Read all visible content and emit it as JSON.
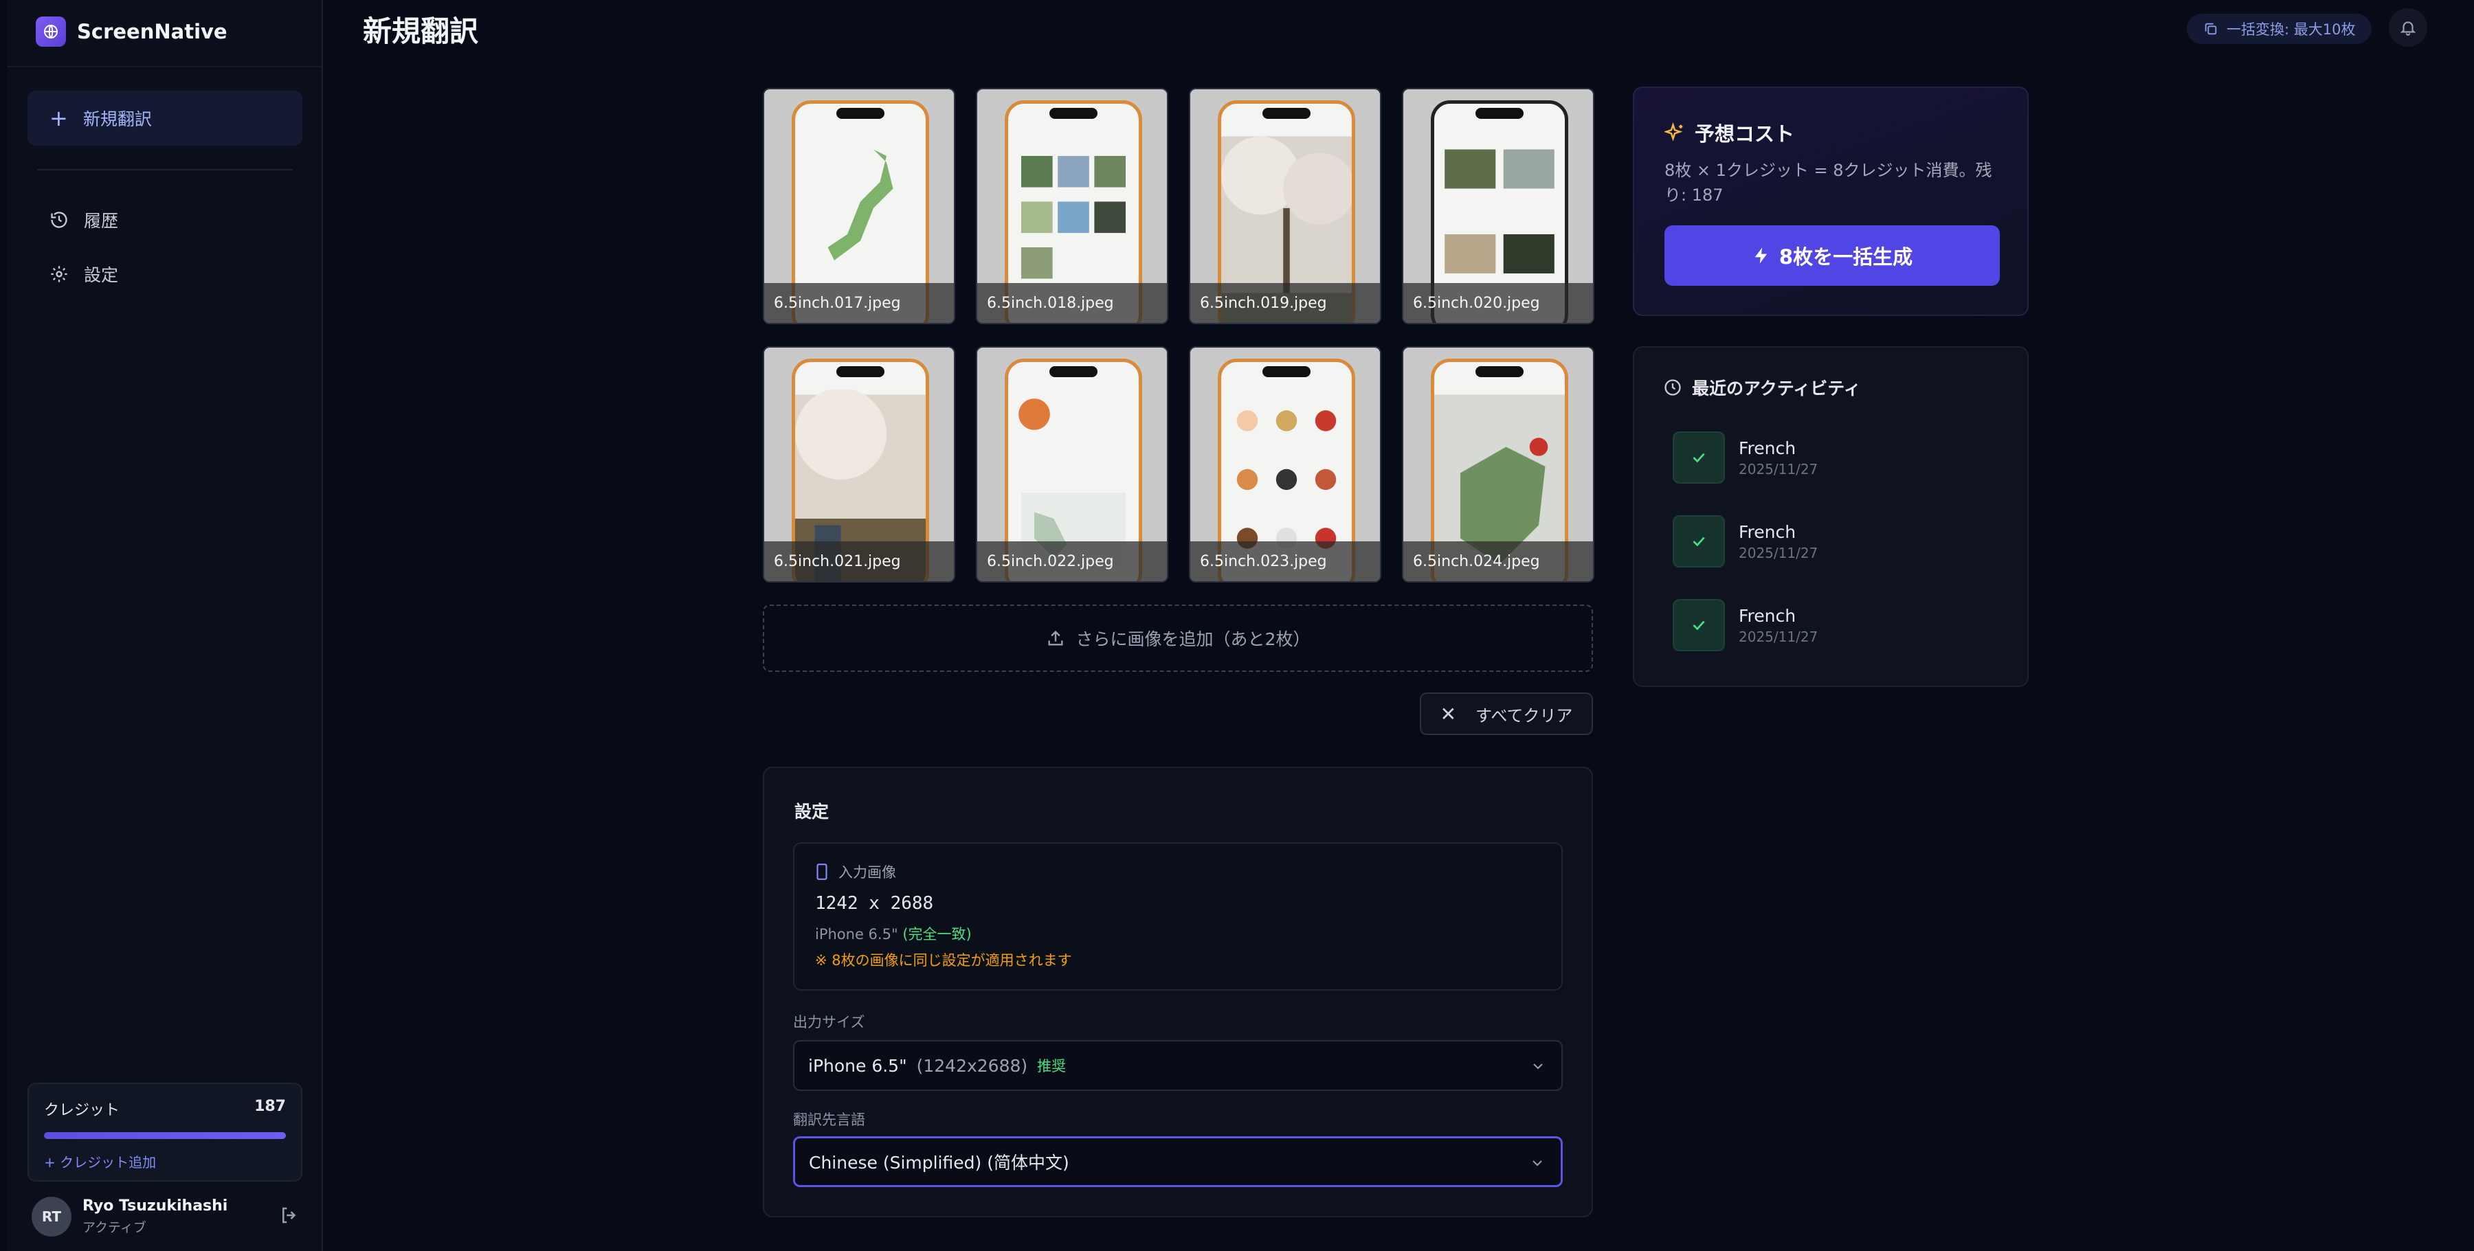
{
  "app": {
    "name": "ScreenNative"
  },
  "sidebar": {
    "new_label": "新規翻訳",
    "items": [
      {
        "label": "履歴",
        "icon": "history-icon"
      },
      {
        "label": "設定",
        "icon": "gear-icon"
      }
    ],
    "credits": {
      "label": "クレジット",
      "value": "187",
      "add_label": "+ クレジット追加",
      "fill_fraction": 1.0
    },
    "user": {
      "initials": "RT",
      "name": "Ryo Tsuzukihashi",
      "status": "アクティブ"
    }
  },
  "header": {
    "title": "新規翻訳",
    "batch_badge": "一括変換: 最大10枚"
  },
  "thumbnails": [
    {
      "filename": "6.5inch.017.jpeg"
    },
    {
      "filename": "6.5inch.018.jpeg"
    },
    {
      "filename": "6.5inch.019.jpeg"
    },
    {
      "filename": "6.5inch.020.jpeg"
    },
    {
      "filename": "6.5inch.021.jpeg"
    },
    {
      "filename": "6.5inch.022.jpeg"
    },
    {
      "filename": "6.5inch.023.jpeg"
    },
    {
      "filename": "6.5inch.024.jpeg"
    }
  ],
  "add_more_label": "さらに画像を追加（あと2枚）",
  "clear_all_label": "すべてクリア",
  "settings": {
    "title": "設定",
    "input": {
      "label": "入力画像",
      "size": "1242  x  2688",
      "device": "iPhone 6.5\"",
      "match": "(完全一致)",
      "note": "※ 8枚の画像に同じ設定が適用されます"
    },
    "output_size": {
      "label": "出力サイズ",
      "value": "iPhone 6.5\"",
      "dims": "(1242x2688)",
      "badge": "推奨"
    },
    "target_language": {
      "label": "翻訳先言語",
      "value": "Chinese (Simplified) (简体中文)"
    }
  },
  "cost": {
    "title": "予想コスト",
    "description": "8枚 × 1クレジット = 8クレジット消費。残り: 187",
    "button_label": "8枚を一括生成"
  },
  "activity": {
    "title": "最近のアクティビティ",
    "items": [
      {
        "language": "French",
        "date": "2025/11/27"
      },
      {
        "language": "French",
        "date": "2025/11/27"
      },
      {
        "language": "French",
        "date": "2025/11/27"
      }
    ]
  },
  "colors": {
    "accent": "#5146e5",
    "background": "#070b18",
    "success": "#4ade80",
    "warning": "#f59e0b"
  }
}
